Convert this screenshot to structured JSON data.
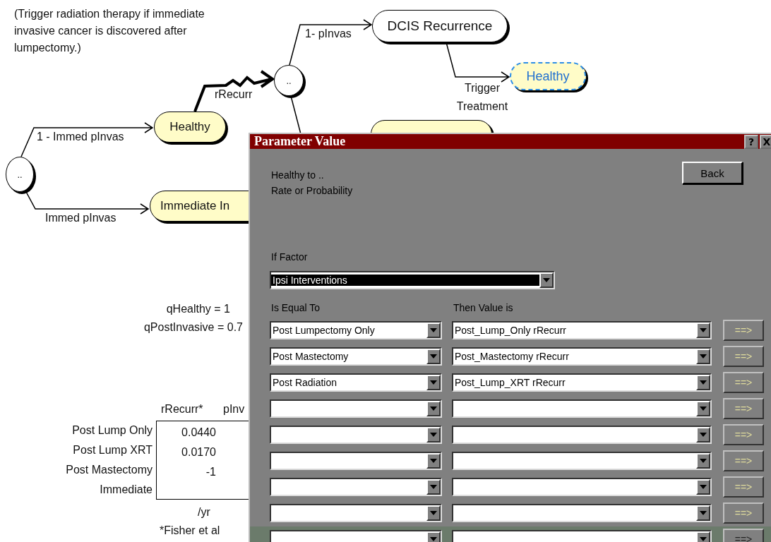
{
  "diagram": {
    "note": "(Trigger radiation therapy if immediate invasive cancer is discovered after lumpectomy.)",
    "nodes": [
      {
        "kind": "chance",
        "label": ".."
      },
      {
        "kind": "state",
        "label": "Healthy"
      },
      {
        "kind": "state",
        "label": "Immediate In"
      },
      {
        "kind": "chance",
        "label": ".."
      },
      {
        "kind": "plain",
        "label": "DCIS Recurrence"
      },
      {
        "kind": "link",
        "label": "Healthy"
      },
      {
        "kind": "state"
      }
    ],
    "branch_labels": [
      "1 - Immed pInvas",
      "Immed pInvas",
      "rRecurr",
      "1- pInvas",
      "Trigger Treatment"
    ]
  },
  "parameters": [
    "qHealthy = 1",
    "qPostInvasive =  0.7"
  ],
  "rate_table": {
    "columns": [
      "rRecurr*",
      "pInv"
    ],
    "rows": [
      {
        "label": "Post Lump Only",
        "value": "0.0440"
      },
      {
        "label": "Post Lump XRT",
        "value": "0.0170"
      },
      {
        "label": "Post Mastectomy",
        "value": "-1"
      },
      {
        "label": "Immediate"
      }
    ],
    "units": "/yr",
    "footnote": "*Fisher et al"
  },
  "dialog": {
    "title": "Parameter Value",
    "help": "?",
    "close": "X",
    "description": [
      "Healthy to ..",
      "Rate or Probability"
    ],
    "back": "Back",
    "factor_label": "If Factor",
    "factor_value": "Ipsi Interventions",
    "columns": [
      "Is Equal To",
      "Then Value is"
    ],
    "rows": [
      {
        "equal": "Post Lumpectomy Only",
        "value": "Post_Lump_Only rRecurr",
        "action": "==>",
        "selected": false
      },
      {
        "equal": "Post Mastectomy",
        "value": "Post_Mastectomy rRecurr",
        "action": "==>",
        "selected": false
      },
      {
        "equal": "Post Radiation",
        "value": "Post_Lump_XRT rRecurr",
        "action": "==>",
        "selected": false
      },
      {
        "action": "==>",
        "selected": false
      },
      {
        "action": "==>",
        "selected": false
      },
      {
        "action": "==>",
        "selected": false
      },
      {
        "action": "==>",
        "selected": false
      },
      {
        "action": "==>",
        "selected": false
      },
      {
        "action": "==>",
        "selected": true
      }
    ]
  }
}
